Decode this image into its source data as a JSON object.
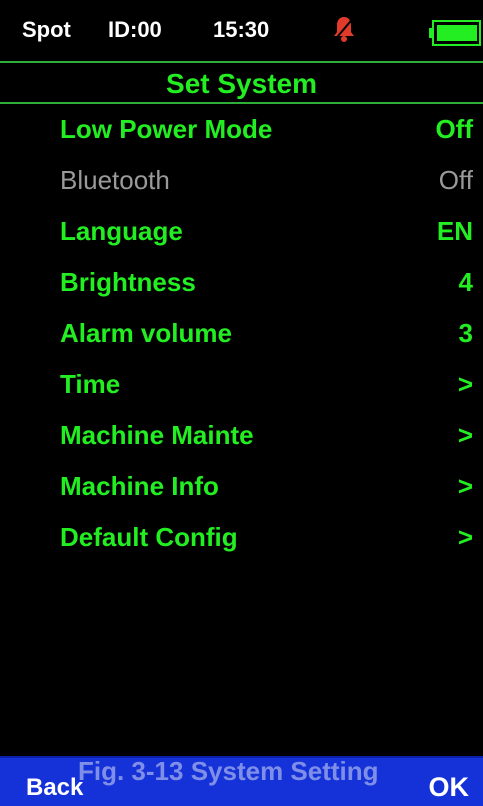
{
  "status_bar": {
    "mode": "Spot",
    "id": "ID:00",
    "time": "15:30",
    "alarm_icon": "bell-muted-icon",
    "battery_icon": "battery-full-icon",
    "battery_color": "#22ee22"
  },
  "screen": {
    "title": "Set System"
  },
  "menu": {
    "items": [
      {
        "label": "Low Power Mode",
        "value": "Off",
        "enabled": true
      },
      {
        "label": "Bluetooth",
        "value": "Off",
        "enabled": false
      },
      {
        "label": "Language",
        "value": "EN",
        "enabled": true
      },
      {
        "label": "Brightness",
        "value": "4",
        "enabled": true
      },
      {
        "label": "Alarm volume",
        "value": "3",
        "enabled": true
      },
      {
        "label": "Time",
        "value": ">",
        "enabled": true
      },
      {
        "label": "Machine Mainte",
        "value": ">",
        "enabled": true
      },
      {
        "label": "Machine Info",
        "value": ">",
        "enabled": true
      },
      {
        "label": "Default Config",
        "value": ">",
        "enabled": true
      }
    ]
  },
  "bottom_bar": {
    "back_label": "Back",
    "ok_label": "OK",
    "background_color": "#1532d8"
  },
  "caption": "Fig. 3-13 System Setting",
  "colors": {
    "accent": "#22ee22",
    "disabled": "#9a9a9a",
    "alarm": "#e03a2a"
  }
}
